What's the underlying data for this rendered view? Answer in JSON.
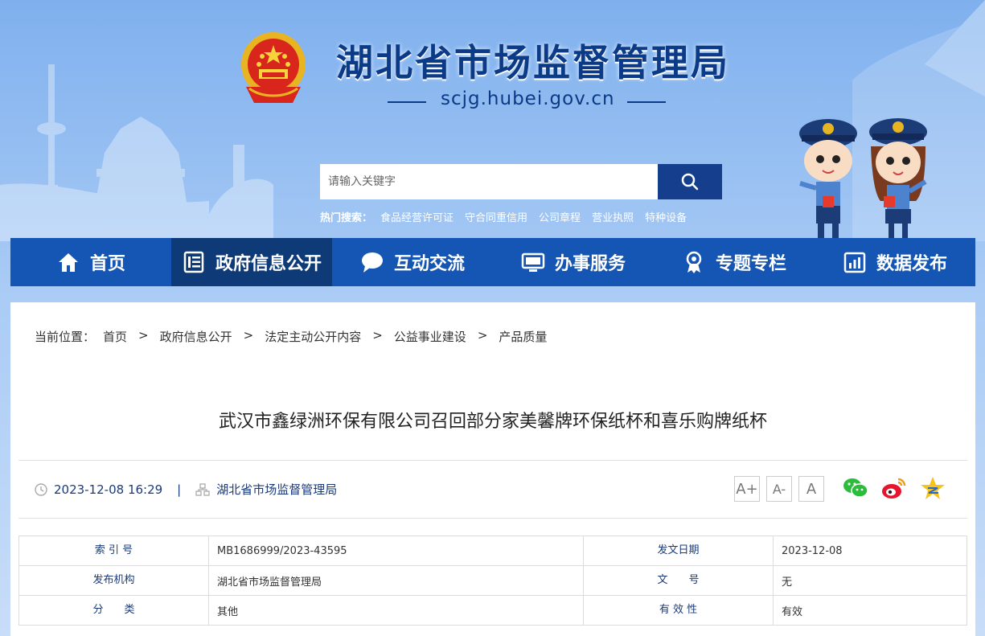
{
  "header": {
    "site_title": "湖北省市场监督管理局",
    "domain": "scjg.hubei.gov.cn"
  },
  "search": {
    "placeholder": "请输入关键字",
    "hot_label": "热门搜索：",
    "hot_items": [
      "食品经营许可证",
      "守合同重信用",
      "公司章程",
      "营业执照",
      "特种设备"
    ]
  },
  "nav": {
    "items": [
      {
        "label": "首页",
        "icon": "home-icon"
      },
      {
        "label": "政府信息公开",
        "icon": "document-list-icon"
      },
      {
        "label": "互动交流",
        "icon": "chat-bubble-icon"
      },
      {
        "label": "办事服务",
        "icon": "monitor-icon"
      },
      {
        "label": "专题专栏",
        "icon": "award-ribbon-icon"
      },
      {
        "label": "数据发布",
        "icon": "bar-chart-icon"
      }
    ],
    "active_index": 1
  },
  "breadcrumb": {
    "label": "当前位置：",
    "items": [
      "首页",
      "政府信息公开",
      "法定主动公开内容",
      "公益事业建设",
      "产品质量"
    ],
    "separator": ">"
  },
  "article": {
    "title": "武汉市鑫绿洲环保有限公司召回部分家美馨牌环保纸杯和喜乐购牌纸杯",
    "datetime": "2023-12-08 16:29",
    "meta_separator": "|",
    "source": "湖北省市场监督管理局"
  },
  "font_controls": [
    "A+",
    "A-",
    "A"
  ],
  "share": [
    "wechat-icon",
    "weibo-icon",
    "qzone-icon"
  ],
  "info_table": {
    "rows": [
      {
        "label1": "索 引 号",
        "value1": "MB1686999/2023-43595",
        "label2": "发文日期",
        "value2": "2023-12-08"
      },
      {
        "label1": "发布机构",
        "value1": "湖北省市场监督管理局",
        "label2": "文　　号",
        "value2": "无"
      },
      {
        "label1": "分　　类",
        "value1": "其他",
        "label2": "有 效 性",
        "value2": "有效"
      }
    ]
  },
  "colors": {
    "nav_bg": "#1556b4",
    "nav_active": "#0e3a78",
    "title_blue": "#0b3a86",
    "search_button": "#153f8c"
  }
}
